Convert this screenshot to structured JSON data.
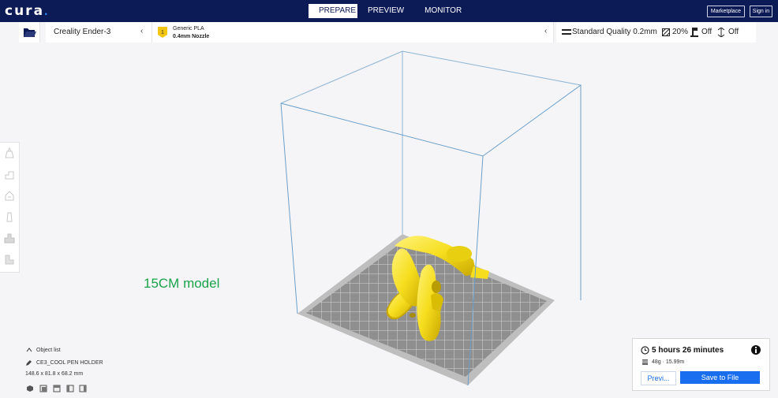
{
  "app": {
    "logo": "cura",
    "logo_dot": "."
  },
  "tabs": [
    "PREPARE",
    "PREVIEW",
    "MONITOR"
  ],
  "header_buttons": {
    "marketplace": "Marketplace",
    "signin": "Sign in"
  },
  "printer": {
    "name": "Creality Ender-3"
  },
  "material": {
    "name": "Generic PLA",
    "nozzle": "0.4mm Nozzle"
  },
  "print_settings": {
    "quality": "Standard Quality 0.2mm",
    "infill": "20%",
    "support": "Off",
    "adhesion": "Off"
  },
  "annotation": "15CM model",
  "object_list": {
    "title": "Object list",
    "item_name": "CE3_COOL PEN HOLDER",
    "dimensions": "148.6 x 81.8 x 68.2 mm"
  },
  "print_panel": {
    "time": "5 hours 26 minutes",
    "details": "48g · 15.99m",
    "preview_label": "Previ...",
    "save_label": "Save to File"
  },
  "colors": {
    "topbar": "#0c1a56",
    "accent": "#196ef0",
    "model": "#f6de1e",
    "label_green": "#1aa34a"
  }
}
